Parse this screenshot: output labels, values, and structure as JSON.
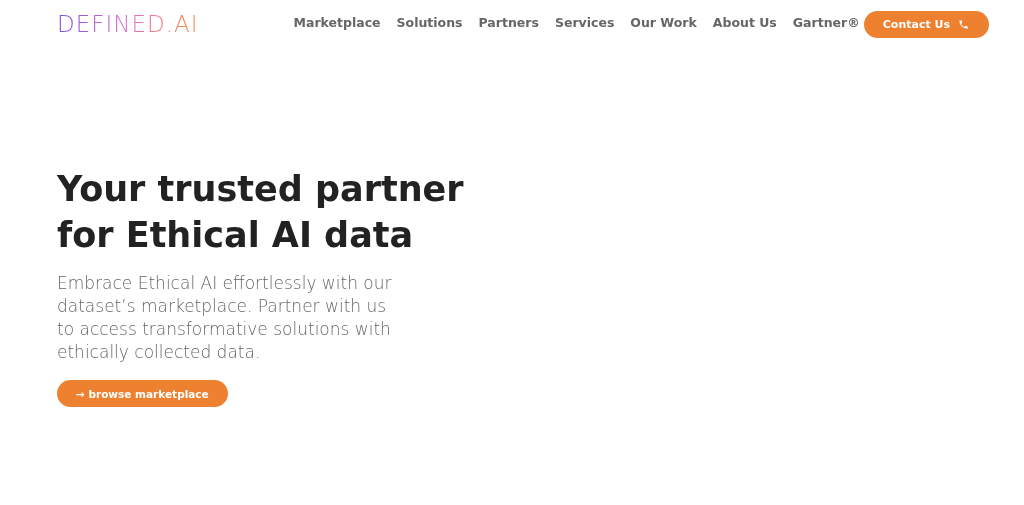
{
  "header": {
    "logo": "DEFINED.AI",
    "nav": [
      {
        "label": "Marketplace"
      },
      {
        "label": "Solutions"
      },
      {
        "label": "Partners"
      },
      {
        "label": "Services"
      },
      {
        "label": "Our Work"
      },
      {
        "label": "About Us"
      },
      {
        "label": "Gartner®"
      }
    ],
    "contact_button": "Contact Us"
  },
  "hero": {
    "title_lines": [
      "Your trusted partner",
      "for Ethical AI data"
    ],
    "text": "Embrace Ethical AI effortlessly with our dataset’s marketplace. Partner with us to access transformative solutions with ethically collected data.",
    "button": "→ browse marketplace"
  }
}
